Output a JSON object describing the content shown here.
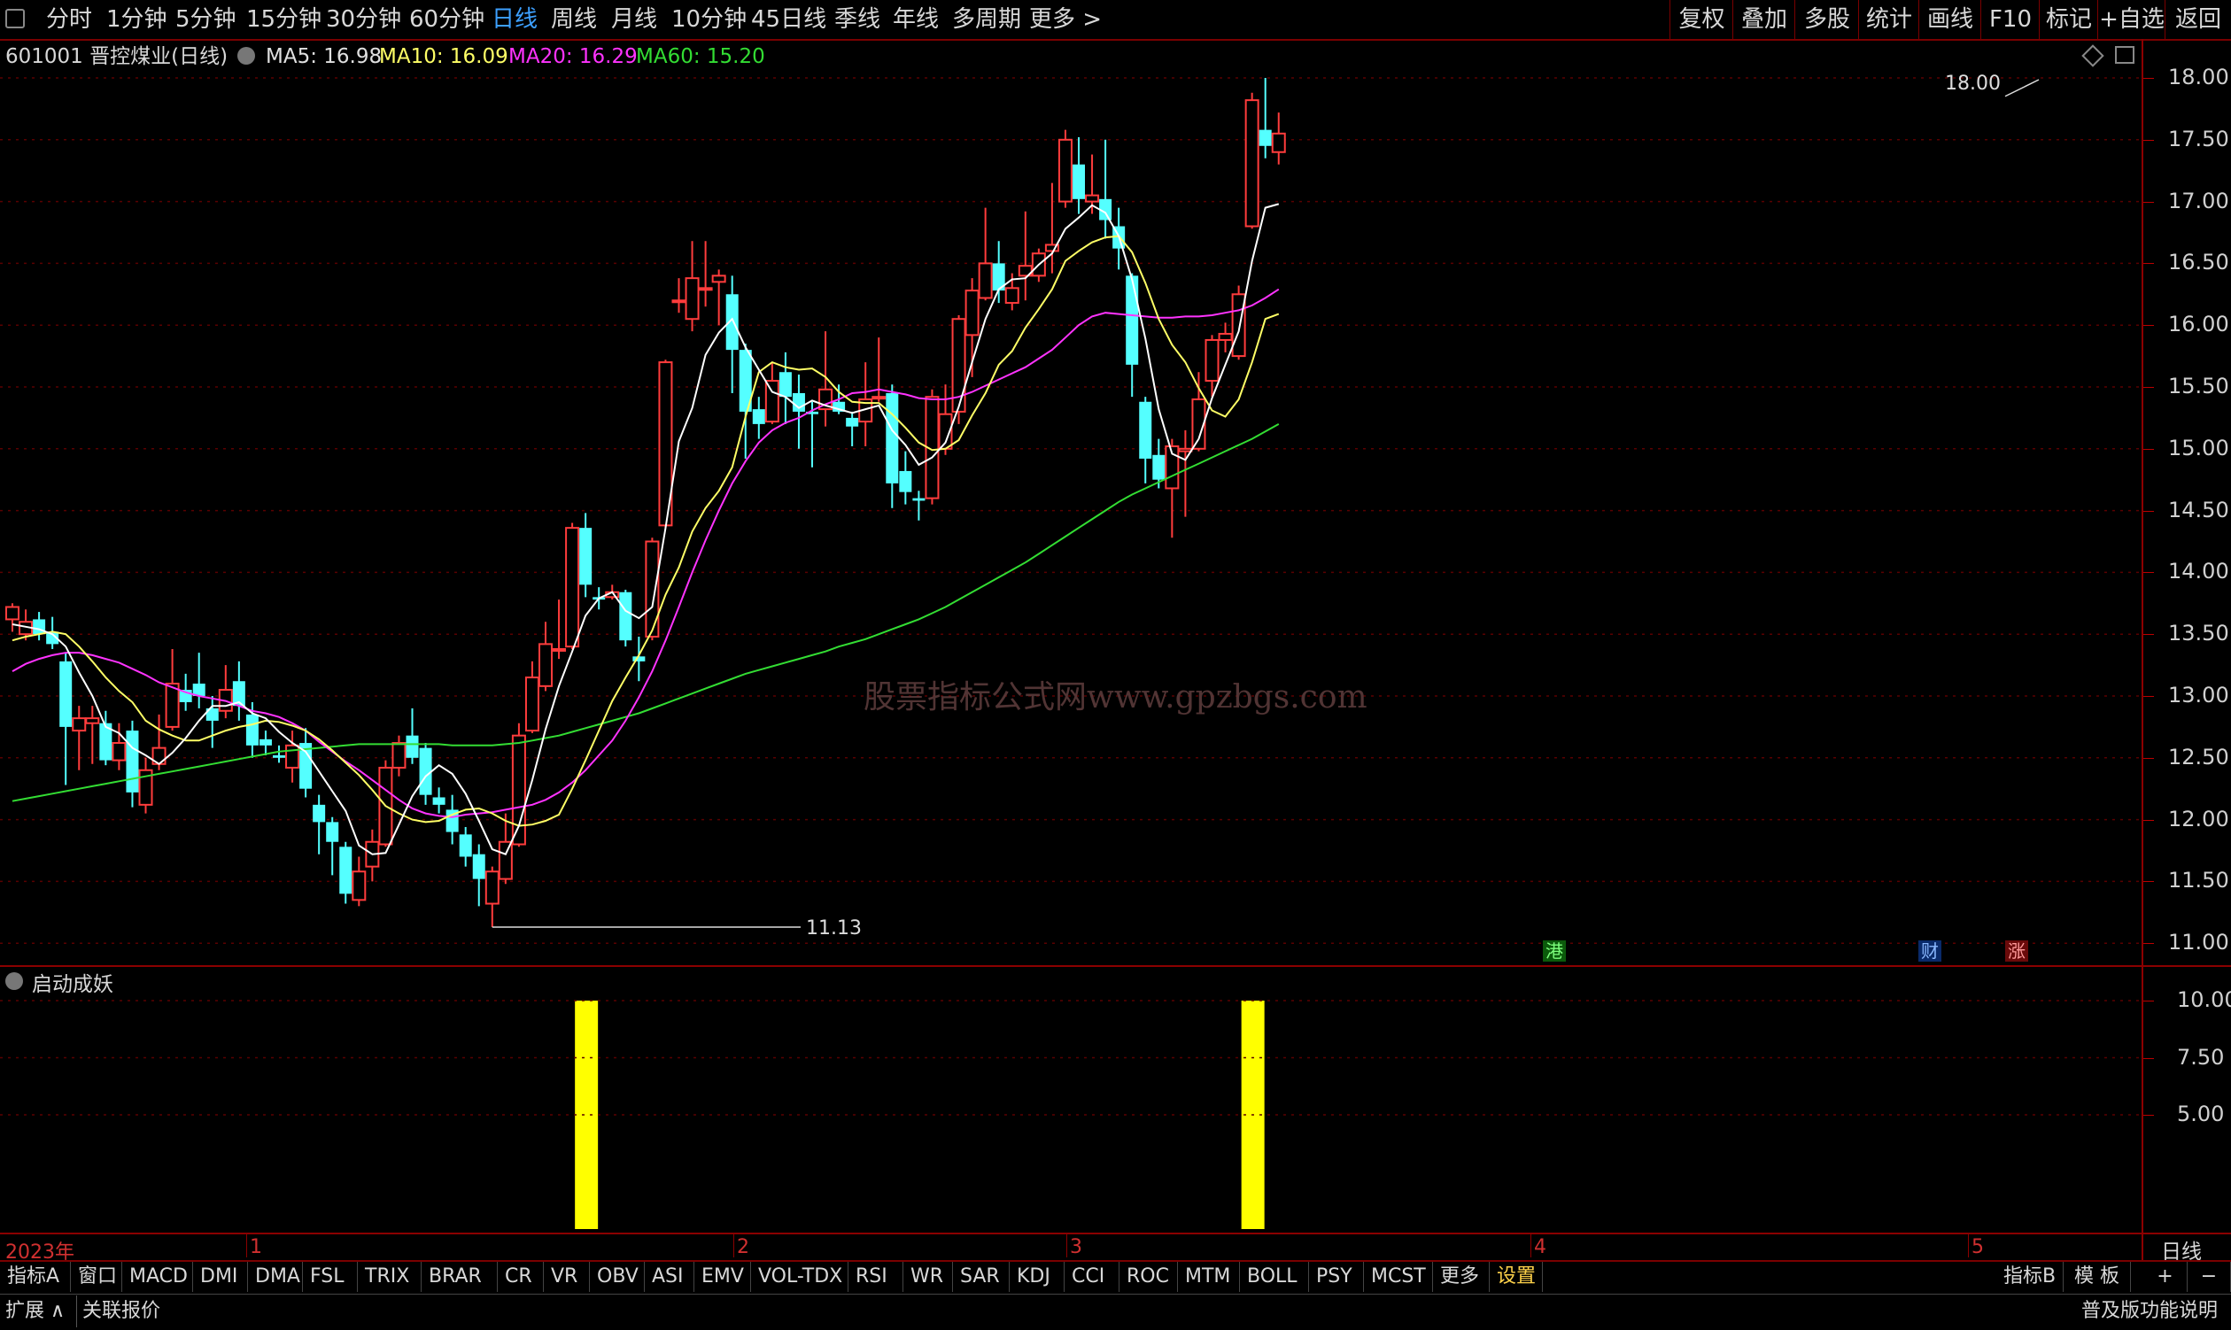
{
  "toolbar": {
    "periods": [
      "分时",
      "1分钟",
      "5分钟",
      "15分钟",
      "30分钟",
      "60分钟",
      "日线",
      "周线",
      "月线",
      "10分钟",
      "45日线",
      "季线",
      "年线",
      "多周期",
      "更多 >"
    ],
    "active_period": "日线",
    "right_buttons": [
      "复权",
      "叠加",
      "多股",
      "统计",
      "画线",
      "F10",
      "标记",
      "+自选",
      "返回"
    ]
  },
  "info": {
    "stock": "601001 晋控煤业(日线)",
    "ma5": "MA5: 16.98",
    "ma10": "MA10: 16.09",
    "ma20": "MA20: 16.29",
    "ma60": "MA60: 15.20"
  },
  "colors": {
    "up": "#ff3c3c",
    "down": "#54ffff",
    "ma5": "#ffffff",
    "ma10": "#ffff66",
    "ma20": "#ff33ff",
    "ma60": "#33dd33",
    "indicator": "#ffff00",
    "border": "#8b0000"
  },
  "annotations": {
    "high_label": "18.00",
    "low_label": "11.13",
    "watermark": "股票指标公式网www.gpzbgs.com",
    "tag_gang": "港",
    "tag_cai": "财",
    "tag_zhang": "涨"
  },
  "x_axis_labels": [
    "2023年",
    "1",
    "2",
    "3",
    "4",
    "5"
  ],
  "period_label": "日线",
  "indicator": {
    "title": "启动成妖",
    "y_ticks": [
      "10.00",
      "7.50",
      "5.00"
    ]
  },
  "bottom_tabs": [
    "指标A",
    "窗口",
    "MACD",
    "DMI",
    "DMA",
    "FSL",
    "TRIX",
    "BRAR",
    "CR",
    "VR",
    "OBV",
    "ASI",
    "EMV",
    "VOL-TDX",
    "RSI",
    "WR",
    "SAR",
    "KDJ",
    "CCI",
    "ROC",
    "MTM",
    "BOLL",
    "PSY",
    "MCST",
    "更多",
    "设置"
  ],
  "bottom_right": [
    "指标B",
    "模 板",
    "+",
    "−"
  ],
  "bottom2": {
    "expand": "扩展 ∧",
    "related": "关联报价",
    "version": "普及版功能说明"
  },
  "chart_data": [
    {
      "type": "candlestick",
      "title": "601001 晋控煤业(日线)",
      "y_ticks": [
        "18.00",
        "17.50",
        "17.00",
        "16.50",
        "16.00",
        "15.50",
        "15.00",
        "14.50",
        "14.00",
        "13.50",
        "13.00",
        "12.50",
        "12.00",
        "11.50",
        "11.00"
      ],
      "ylim": [
        10.95,
        18.25
      ],
      "grid": true,
      "candles": [
        [
          13.62,
          13.72,
          13.52,
          13.75
        ],
        [
          13.5,
          13.6,
          13.45,
          13.7
        ],
        [
          13.62,
          13.5,
          13.45,
          13.68
        ],
        [
          13.52,
          13.42,
          13.38,
          13.64
        ],
        [
          13.28,
          12.75,
          12.28,
          13.35
        ],
        [
          12.72,
          12.82,
          12.4,
          12.92
        ],
        [
          12.78,
          12.82,
          12.45,
          12.92
        ],
        [
          12.78,
          12.48,
          12.44,
          12.88
        ],
        [
          12.48,
          12.62,
          12.4,
          12.78
        ],
        [
          12.72,
          12.22,
          12.1,
          12.8
        ],
        [
          12.12,
          12.4,
          12.05,
          12.5
        ],
        [
          12.45,
          12.58,
          12.4,
          12.85
        ],
        [
          12.75,
          13.1,
          12.72,
          13.38
        ],
        [
          13.05,
          12.95,
          12.88,
          13.18
        ],
        [
          13.1,
          13.0,
          12.9,
          13.35
        ],
        [
          12.9,
          12.8,
          12.58,
          13.0
        ],
        [
          12.88,
          13.05,
          12.82,
          13.25
        ],
        [
          13.12,
          12.92,
          12.8,
          13.28
        ],
        [
          12.85,
          12.6,
          12.5,
          12.95
        ],
        [
          12.65,
          12.6,
          12.52,
          12.72
        ],
        [
          12.52,
          12.5,
          12.46,
          12.6
        ],
        [
          12.42,
          12.6,
          12.3,
          12.72
        ],
        [
          12.62,
          12.25,
          12.18,
          12.74
        ],
        [
          12.12,
          11.98,
          11.72,
          12.2
        ],
        [
          11.98,
          11.82,
          11.55,
          12.02
        ],
        [
          11.78,
          11.4,
          11.32,
          11.82
        ],
        [
          11.35,
          11.58,
          11.3,
          11.7
        ],
        [
          11.62,
          11.82,
          11.5,
          11.92
        ],
        [
          11.8,
          12.42,
          11.78,
          12.48
        ],
        [
          12.42,
          12.62,
          12.35,
          12.68
        ],
        [
          12.68,
          12.5,
          12.45,
          12.9
        ],
        [
          12.58,
          12.2,
          12.12,
          12.62
        ],
        [
          12.18,
          12.12,
          12.05,
          12.26
        ],
        [
          12.08,
          11.9,
          11.8,
          12.2
        ],
        [
          11.88,
          11.7,
          11.62,
          11.94
        ],
        [
          11.72,
          11.52,
          11.3,
          11.8
        ],
        [
          11.32,
          11.58,
          11.13,
          11.62
        ],
        [
          11.52,
          11.82,
          11.48,
          12.05
        ],
        [
          11.8,
          12.68,
          11.78,
          12.78
        ],
        [
          12.72,
          13.15,
          12.7,
          13.28
        ],
        [
          13.08,
          13.42,
          13.04,
          13.6
        ],
        [
          13.38,
          13.38,
          13.3,
          13.78
        ],
        [
          13.4,
          14.36,
          13.38,
          14.4
        ],
        [
          14.36,
          13.9,
          13.8,
          14.48
        ],
        [
          13.8,
          13.78,
          13.7,
          13.88
        ],
        [
          13.8,
          13.84,
          13.78,
          13.9
        ],
        [
          13.84,
          13.45,
          13.4,
          13.86
        ],
        [
          13.32,
          13.28,
          13.12,
          13.48
        ],
        [
          13.48,
          14.25,
          13.45,
          14.28
        ],
        [
          14.38,
          15.7,
          14.36,
          15.72
        ],
        [
          16.2,
          16.2,
          16.1,
          16.38
        ],
        [
          16.05,
          16.38,
          15.95,
          16.68
        ],
        [
          16.3,
          16.3,
          16.15,
          16.68
        ],
        [
          16.35,
          16.4,
          16.0,
          16.45
        ],
        [
          16.25,
          15.8,
          15.45,
          16.4
        ],
        [
          15.8,
          15.3,
          14.92,
          15.85
        ],
        [
          15.32,
          15.2,
          15.08,
          15.42
        ],
        [
          15.22,
          15.55,
          15.2,
          15.7
        ],
        [
          15.62,
          15.42,
          15.2,
          15.78
        ],
        [
          15.45,
          15.3,
          15.0,
          15.6
        ],
        [
          15.3,
          15.28,
          14.85,
          15.38
        ],
        [
          15.32,
          15.48,
          15.18,
          15.95
        ],
        [
          15.38,
          15.3,
          15.28,
          15.52
        ],
        [
          15.25,
          15.18,
          15.02,
          15.3
        ],
        [
          15.22,
          15.4,
          15.02,
          15.7
        ],
        [
          15.42,
          15.42,
          15.38,
          15.9
        ],
        [
          15.45,
          14.72,
          14.52,
          15.52
        ],
        [
          14.82,
          14.65,
          14.55,
          14.98
        ],
        [
          14.6,
          14.58,
          14.42,
          14.66
        ],
        [
          14.6,
          15.42,
          14.55,
          15.48
        ],
        [
          15.0,
          15.28,
          14.95,
          15.52
        ],
        [
          15.3,
          16.05,
          15.2,
          16.08
        ],
        [
          15.92,
          16.28,
          15.58,
          16.38
        ],
        [
          16.22,
          16.5,
          16.2,
          16.95
        ],
        [
          16.5,
          16.28,
          16.18,
          16.68
        ],
        [
          16.18,
          16.3,
          16.12,
          16.42
        ],
        [
          16.4,
          16.48,
          16.2,
          16.92
        ],
        [
          16.4,
          16.58,
          16.35,
          16.62
        ],
        [
          16.6,
          16.65,
          16.42,
          17.15
        ],
        [
          17.0,
          17.5,
          16.95,
          17.58
        ],
        [
          17.3,
          17.02,
          16.9,
          17.52
        ],
        [
          17.0,
          17.05,
          16.9,
          17.38
        ],
        [
          17.02,
          16.85,
          16.7,
          17.5
        ],
        [
          16.8,
          16.62,
          16.45,
          16.95
        ],
        [
          16.4,
          15.68,
          15.42,
          16.42
        ],
        [
          15.38,
          14.92,
          14.72,
          15.42
        ],
        [
          14.95,
          14.75,
          14.68,
          15.08
        ],
        [
          14.68,
          15.02,
          14.28,
          15.08
        ],
        [
          14.98,
          15.0,
          14.45,
          15.15
        ],
        [
          15.0,
          15.4,
          14.98,
          15.62
        ],
        [
          15.55,
          15.88,
          15.42,
          15.92
        ],
        [
          15.88,
          15.93,
          15.78,
          16.02
        ],
        [
          15.75,
          16.25,
          15.72,
          16.32
        ],
        [
          16.8,
          17.82,
          16.78,
          17.88
        ],
        [
          17.58,
          17.45,
          17.35,
          18.0
        ],
        [
          17.4,
          17.55,
          17.3,
          17.72
        ]
      ],
      "ma5": [
        13.58,
        13.56,
        13.54,
        13.5,
        13.4,
        13.19,
        13.0,
        12.75,
        12.7,
        12.58,
        12.52,
        12.45,
        12.54,
        12.66,
        12.8,
        12.92,
        12.92,
        12.95,
        12.86,
        12.82,
        12.71,
        12.62,
        12.55,
        12.39,
        12.23,
        12.07,
        11.79,
        11.72,
        11.73,
        11.96,
        12.19,
        12.35,
        12.44,
        12.37,
        12.21,
        11.99,
        11.76,
        11.72,
        11.95,
        12.32,
        12.73,
        13.08,
        13.36,
        13.65,
        13.79,
        13.84,
        13.69,
        13.63,
        13.72,
        14.36,
        15.06,
        15.33,
        15.76,
        15.94,
        16.05,
        15.82,
        15.64,
        15.46,
        15.42,
        15.33,
        15.39,
        15.35,
        15.32,
        15.29,
        15.32,
        15.35,
        15.15,
        15.03,
        14.87,
        14.93,
        15.05,
        15.34,
        15.7,
        16.05,
        16.29,
        16.37,
        16.38,
        16.49,
        16.58,
        16.78,
        16.87,
        16.97,
        16.91,
        16.72,
        16.37,
        15.89,
        15.32,
        14.96,
        14.91,
        15.08,
        15.41,
        15.68,
        15.95,
        16.52,
        16.95,
        16.98
      ],
      "ma10": [
        13.45,
        13.48,
        13.5,
        13.52,
        13.5,
        13.4,
        13.28,
        13.15,
        13.04,
        12.95,
        12.8,
        12.73,
        12.68,
        12.64,
        12.64,
        12.68,
        12.72,
        12.75,
        12.77,
        12.8,
        12.79,
        12.76,
        12.72,
        12.65,
        12.56,
        12.46,
        12.36,
        12.24,
        12.11,
        12.05,
        12.0,
        11.98,
        11.99,
        12.04,
        12.08,
        12.09,
        12.05,
        11.99,
        11.95,
        11.96,
        11.99,
        12.04,
        12.25,
        12.48,
        12.72,
        12.96,
        13.15,
        13.33,
        13.53,
        13.82,
        14.04,
        14.33,
        14.52,
        14.66,
        14.85,
        15.26,
        15.62,
        15.7,
        15.66,
        15.64,
        15.65,
        15.58,
        15.46,
        15.38,
        15.37,
        15.37,
        15.28,
        15.17,
        15.05,
        14.99,
        15.0,
        15.07,
        15.27,
        15.45,
        15.68,
        15.79,
        15.98,
        16.13,
        16.29,
        16.52,
        16.6,
        16.67,
        16.71,
        16.72,
        16.59,
        16.34,
        16.05,
        15.84,
        15.7,
        15.49,
        15.31,
        15.26,
        15.4,
        15.7,
        16.05,
        16.09
      ],
      "ma20": [
        13.2,
        13.26,
        13.3,
        13.33,
        13.35,
        13.35,
        13.33,
        13.3,
        13.27,
        13.22,
        13.17,
        13.11,
        13.07,
        13.03,
        13.0,
        12.98,
        12.96,
        12.92,
        12.88,
        12.86,
        12.83,
        12.78,
        12.72,
        12.63,
        12.55,
        12.47,
        12.4,
        12.32,
        12.24,
        12.16,
        12.09,
        12.05,
        12.03,
        12.02,
        12.04,
        12.05,
        12.06,
        12.08,
        12.1,
        12.12,
        12.16,
        12.22,
        12.3,
        12.4,
        12.52,
        12.64,
        12.8,
        12.99,
        13.2,
        13.45,
        13.72,
        14.0,
        14.26,
        14.5,
        14.72,
        14.9,
        15.05,
        15.15,
        15.21,
        15.25,
        15.31,
        15.36,
        15.4,
        15.45,
        15.46,
        15.48,
        15.46,
        15.44,
        15.41,
        15.4,
        15.4,
        15.42,
        15.46,
        15.51,
        15.56,
        15.61,
        15.66,
        15.73,
        15.8,
        15.9,
        16.0,
        16.07,
        16.1,
        16.09,
        16.08,
        16.07,
        16.06,
        16.06,
        16.07,
        16.07,
        16.08,
        16.1,
        16.12,
        16.16,
        16.22,
        16.29
      ],
      "ma60": [
        12.15,
        12.17,
        12.19,
        12.21,
        12.23,
        12.25,
        12.27,
        12.29,
        12.31,
        12.33,
        12.35,
        12.37,
        12.39,
        12.41,
        12.43,
        12.45,
        12.47,
        12.49,
        12.51,
        12.53,
        12.55,
        12.56,
        12.57,
        12.58,
        12.59,
        12.6,
        12.61,
        12.61,
        12.61,
        12.61,
        12.61,
        12.61,
        12.61,
        12.6,
        12.6,
        12.6,
        12.6,
        12.61,
        12.62,
        12.64,
        12.66,
        12.68,
        12.71,
        12.74,
        12.77,
        12.8,
        12.83,
        12.86,
        12.9,
        12.94,
        12.98,
        13.02,
        13.06,
        13.1,
        13.14,
        13.18,
        13.21,
        13.24,
        13.27,
        13.3,
        13.33,
        13.36,
        13.4,
        13.43,
        13.46,
        13.5,
        13.54,
        13.58,
        13.62,
        13.67,
        13.72,
        13.78,
        13.84,
        13.9,
        13.96,
        14.02,
        14.08,
        14.15,
        14.22,
        14.29,
        14.36,
        14.43,
        14.5,
        14.57,
        14.63,
        14.68,
        14.73,
        14.78,
        14.83,
        14.88,
        14.93,
        14.98,
        15.03,
        15.08,
        15.14,
        15.2
      ]
    },
    {
      "type": "bar",
      "title": "启动成妖",
      "ylim": [
        0,
        10.5
      ],
      "signals": [
        {
          "index": 43,
          "value": 10
        },
        {
          "index": 93,
          "value": 10
        }
      ]
    }
  ]
}
